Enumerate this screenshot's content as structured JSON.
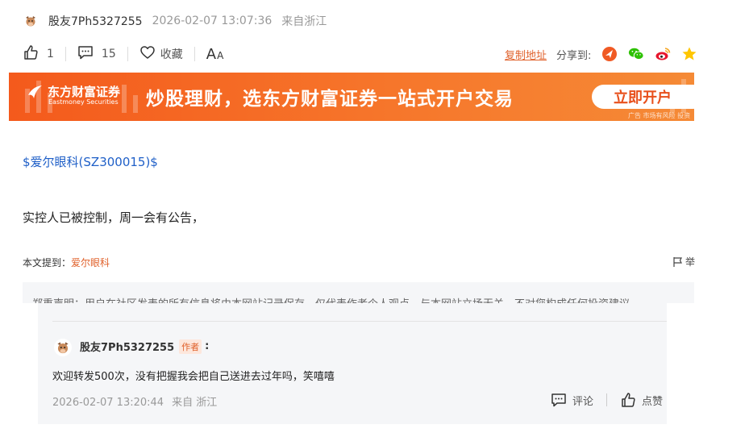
{
  "post": {
    "username": "股友7Ph5327255",
    "time": "2026-02-07 13:07:36",
    "from": "来自浙江"
  },
  "actions": {
    "like_count": "1",
    "comment_count": "15",
    "favorite_label": "收藏",
    "font_label_big": "A",
    "font_label_small": "A",
    "copy_link_label": "复制地址",
    "share_label": "分享到:"
  },
  "banner": {
    "logo_name": "东方财富证券",
    "logo_en": "Eastmoney Securities",
    "slogan": "炒股理财，选东方财富证券一站式开户交易",
    "button_label": "立即开户",
    "ad_note": "广告 市场有风险 投资"
  },
  "body": {
    "stock_link": "$爱尔眼科(SZ300015)$",
    "content": "实控人已被控制，周一会有公告，",
    "mention_prefix": "本文提到：",
    "mention_stock": "爱尔眼科",
    "report_label": "举"
  },
  "disclaimer": "郑重声明：用户在社区发表的所有信息将由本网站记录保存，仅代表作者个人观点，与本网站立场无关，不对您构成任何投资建议",
  "reply": {
    "username": "股友7Ph5327255",
    "badge": "作者",
    "colon": ":",
    "text": "欢迎转发500次，没有把握我会把自己送进去过年吗，笑嘻嘻",
    "time": "2026-02-07 13:20:44",
    "from": "来自 浙江",
    "comment_label": "评论",
    "like_label": "点赞"
  },
  "colors": {
    "accent": "#e0612b",
    "link": "#2060c8",
    "banner_start": "#f45a1c",
    "banner_end": "#f58a36"
  }
}
